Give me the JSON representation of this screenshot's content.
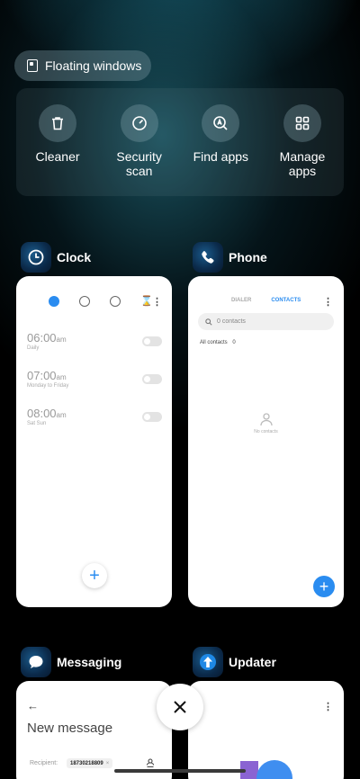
{
  "floating_windows": {
    "label": "Floating windows",
    "icon": "floating-window-icon"
  },
  "quick_actions": [
    {
      "label": "Cleaner",
      "icon": "trash-icon"
    },
    {
      "label": "Security scan",
      "icon": "security-scan-icon"
    },
    {
      "label": "Find apps",
      "icon": "find-apps-icon"
    },
    {
      "label": "Manage apps",
      "icon": "grid-icon"
    }
  ],
  "apps": {
    "clock": {
      "name": "Clock",
      "alarms": [
        {
          "hour": "06:00",
          "ampm": "am",
          "repeat": "Daily"
        },
        {
          "hour": "07:00",
          "ampm": "am",
          "repeat": "Monday to Friday"
        },
        {
          "hour": "08:00",
          "ampm": "am",
          "repeat": "Sat Sun"
        }
      ]
    },
    "phone": {
      "name": "Phone",
      "tabs": {
        "dialer": "DIALER",
        "contacts": "CONTACTS"
      },
      "search_placeholder": "0 contacts",
      "all_contacts_label": "All contacts",
      "all_contacts_count": "0",
      "empty_text": "No contacts"
    },
    "messaging": {
      "name": "Messaging",
      "title": "New message",
      "recipient_label": "Recipient:",
      "recipient_value": "18730218809"
    },
    "updater": {
      "name": "Updater"
    }
  },
  "colors": {
    "accent": "#2a8cf0",
    "chip_bg": "#5e7a82"
  }
}
